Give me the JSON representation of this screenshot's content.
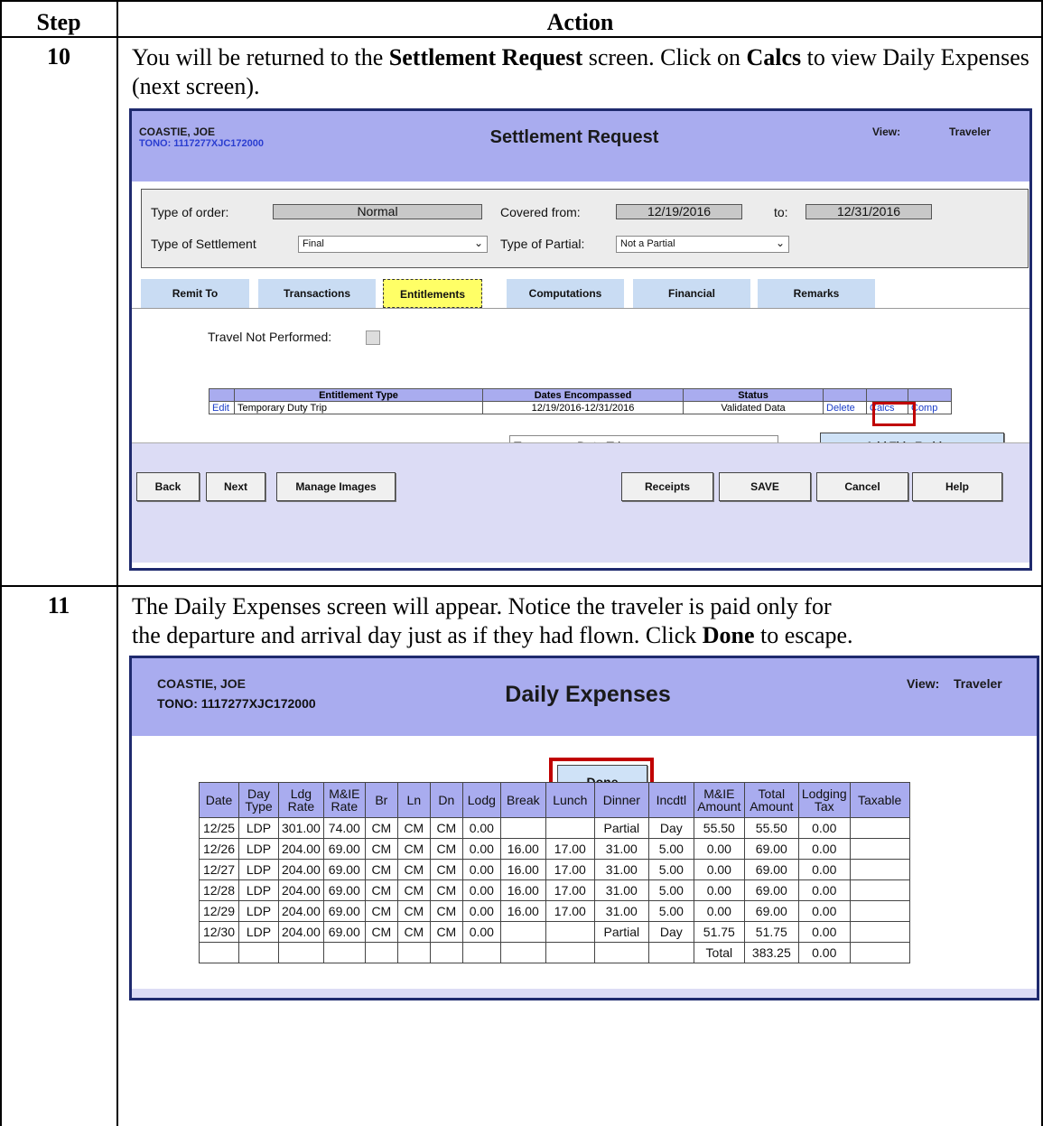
{
  "doc": {
    "header_step": "Step",
    "header_action": "Action"
  },
  "step10": {
    "number": "10",
    "text_1": "You will be returned to the ",
    "text_bold_1": "Settlement Request",
    "text_2": " screen.  Click on ",
    "text_bold_2": "Calcs",
    "text_3": " to view Daily Expenses (next screen).",
    "screen": {
      "name": "COASTIE, JOE",
      "tono": "TONO: 1117277XJC172000",
      "title": "Settlement Request",
      "view_label": "View:",
      "view_value": "Traveler",
      "type_of_order_label": "Type of order:",
      "type_of_order_value": "Normal",
      "covered_from_label": "Covered from:",
      "covered_from_value": "12/19/2016",
      "to_label": "to:",
      "to_value": "12/31/2016",
      "type_of_settlement_label": "Type of Settlement",
      "type_of_settlement_value": "Final",
      "type_of_partial_label": "Type of Partial:",
      "type_of_partial_value": "Not a Partial",
      "tabs": [
        "Remit To",
        "Transactions",
        "Entitlements",
        "Computations",
        "Financial",
        "Remarks"
      ],
      "active_tab": "Entitlements",
      "travel_not_performed_label": "Travel Not Performed:",
      "table_headers": [
        "",
        "Entitlement Type",
        "Dates Encompassed",
        "Status",
        "",
        "",
        ""
      ],
      "table_row": {
        "edit": "Edit",
        "type": "Temporary Duty Trip",
        "dates": "12/19/2016-12/31/2016",
        "status": "Validated Data",
        "delete": "Delete",
        "calcs": "Calcs",
        "comp": "Comp"
      },
      "entitlement_select": "Temporary Duty Trip",
      "add_entitlement_button": "<= Add This Entitlement",
      "buttons": {
        "back": "Back",
        "next": "Next",
        "manage_images": "Manage Images",
        "receipts": "Receipts",
        "save": "SAVE",
        "cancel": "Cancel",
        "help": "Help"
      }
    }
  },
  "step11": {
    "number": "11",
    "text_1": "The Daily Expenses screen will appear.  Notice the traveler is paid only for",
    "text_2": "the departure and arrival day just as if they had flown.  Click ",
    "text_bold": "Done",
    "text_3": " to escape.",
    "screen": {
      "name": "COASTIE, JOE",
      "tono": "TONO: 1117277XJC172000",
      "title": "Daily Expenses",
      "view_label": "View:",
      "view_value": "Traveler",
      "done_button": "Done",
      "columns": [
        "Date",
        "Day Type",
        "Ldg Rate",
        "M&IE Rate",
        "Br",
        "Ln",
        "Dn",
        "Lodg",
        "Break",
        "Lunch",
        "Dinner",
        "Incdtl",
        "M&IE Amount",
        "Total Amount",
        "Lodging Tax",
        "Taxable"
      ],
      "rows": [
        [
          "12/25",
          "LDP",
          "301.00",
          "74.00",
          "CM",
          "CM",
          "CM",
          "0.00",
          "",
          "",
          "Partial",
          "Day",
          "55.50",
          "55.50",
          "0.00",
          ""
        ],
        [
          "12/26",
          "LDP",
          "204.00",
          "69.00",
          "CM",
          "CM",
          "CM",
          "0.00",
          "16.00",
          "17.00",
          "31.00",
          "5.00",
          "0.00",
          "69.00",
          "0.00",
          ""
        ],
        [
          "12/27",
          "LDP",
          "204.00",
          "69.00",
          "CM",
          "CM",
          "CM",
          "0.00",
          "16.00",
          "17.00",
          "31.00",
          "5.00",
          "0.00",
          "69.00",
          "0.00",
          ""
        ],
        [
          "12/28",
          "LDP",
          "204.00",
          "69.00",
          "CM",
          "CM",
          "CM",
          "0.00",
          "16.00",
          "17.00",
          "31.00",
          "5.00",
          "0.00",
          "69.00",
          "0.00",
          ""
        ],
        [
          "12/29",
          "LDP",
          "204.00",
          "69.00",
          "CM",
          "CM",
          "CM",
          "0.00",
          "16.00",
          "17.00",
          "31.00",
          "5.00",
          "0.00",
          "69.00",
          "0.00",
          ""
        ],
        [
          "12/30",
          "LDP",
          "204.00",
          "69.00",
          "CM",
          "CM",
          "CM",
          "0.00",
          "",
          "",
          "Partial",
          "Day",
          "51.75",
          "51.75",
          "0.00",
          ""
        ],
        [
          "",
          "",
          "",
          "",
          "",
          "",
          "",
          "",
          "",
          "",
          "",
          "",
          "Total",
          "383.25",
          "0.00",
          ""
        ]
      ]
    }
  }
}
